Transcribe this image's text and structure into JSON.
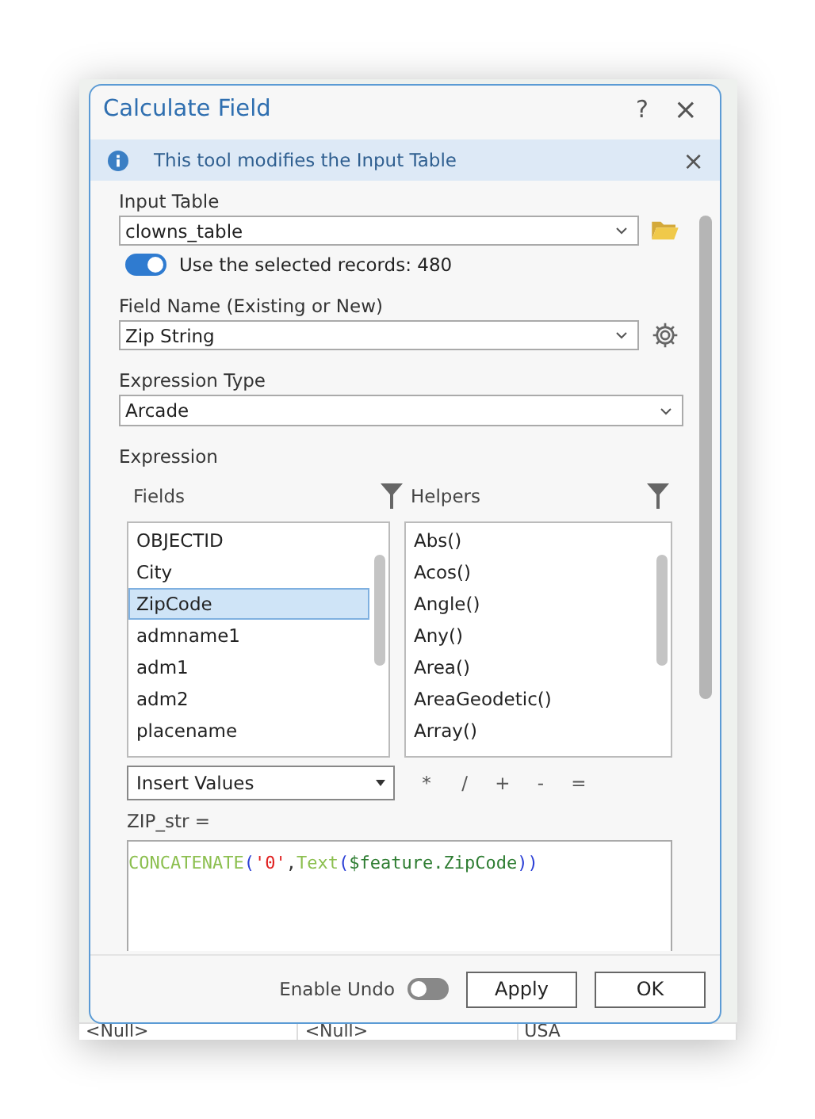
{
  "background_table": {
    "cells": [
      "<Null>",
      "<Null>",
      "USA"
    ]
  },
  "dialog": {
    "title": "Calculate Field",
    "help": "?",
    "close": "×"
  },
  "info_bar": {
    "text": "This tool modifies the Input Table",
    "close": "×"
  },
  "input_table": {
    "label": "Input Table",
    "value": "clowns_table"
  },
  "use_selected": {
    "label": "Use the selected records: 480",
    "on": true
  },
  "field_name": {
    "label": "Field Name (Existing or New)",
    "value": "Zip String"
  },
  "expression_type": {
    "label": "Expression Type",
    "value": "Arcade"
  },
  "expression": {
    "label": "Expression",
    "fields": {
      "label": "Fields",
      "items": [
        {
          "text": "OBJECTID",
          "selected": false
        },
        {
          "text": "City",
          "selected": false
        },
        {
          "text": "ZipCode",
          "selected": true
        },
        {
          "text": "admname1",
          "selected": false
        },
        {
          "text": "adm1",
          "selected": false
        },
        {
          "text": "adm2",
          "selected": false
        },
        {
          "text": "placename",
          "selected": false
        }
      ]
    },
    "helpers": {
      "label": "Helpers",
      "items": [
        {
          "text": "Abs()",
          "selected": false
        },
        {
          "text": "Acos()",
          "selected": false
        },
        {
          "text": "Angle()",
          "selected": false
        },
        {
          "text": "Any()",
          "selected": false
        },
        {
          "text": "Area()",
          "selected": false
        },
        {
          "text": "AreaGeodetic()",
          "selected": false
        },
        {
          "text": "Array()",
          "selected": false
        }
      ]
    },
    "insert": "Insert Values",
    "operators": [
      "*",
      "/",
      "+",
      "-",
      "="
    ],
    "target": "ZIP_str =",
    "code": [
      {
        "text": "CONCATENATE",
        "kind": "function"
      },
      {
        "text": "(",
        "kind": "paren"
      },
      {
        "text": "'0'",
        "kind": "string"
      },
      {
        "text": ",",
        "kind": "plain"
      },
      {
        "text": "Text",
        "kind": "function"
      },
      {
        "text": "(",
        "kind": "paren"
      },
      {
        "text": "$feature.ZipCode",
        "kind": "variable"
      },
      {
        "text": "))",
        "kind": "paren"
      }
    ]
  },
  "footer": {
    "undo_label": "Enable Undo",
    "undo_on": false,
    "buttons": [
      "Apply",
      "OK"
    ]
  }
}
